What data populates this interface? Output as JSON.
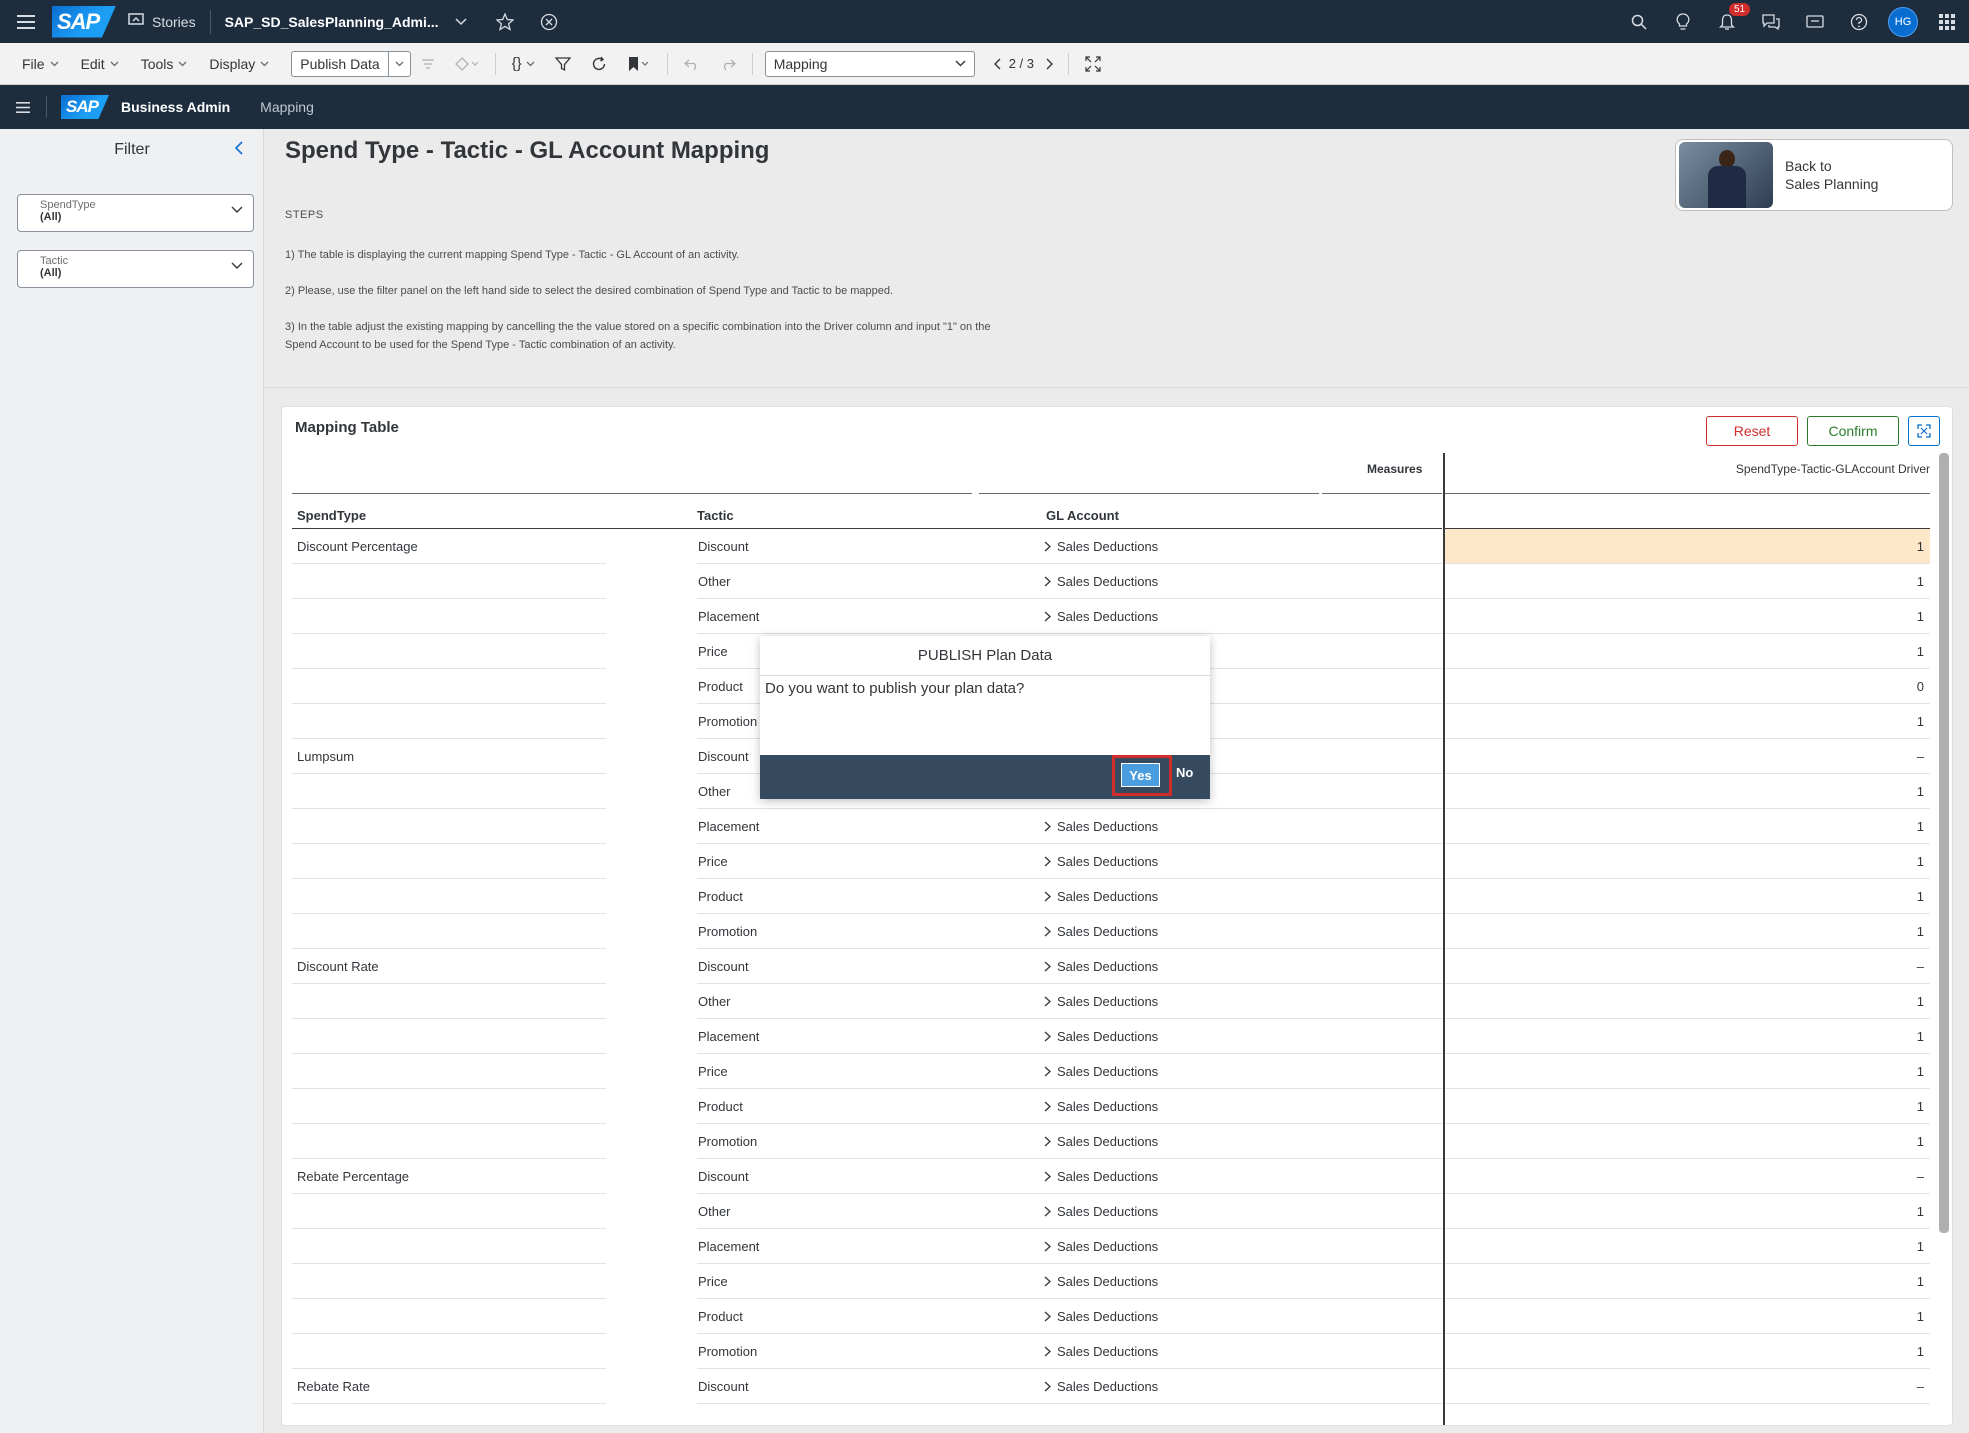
{
  "shell": {
    "logo": "SAP",
    "stories_label": "Stories",
    "story_title": "SAP_SD_SalesPlanning_Admi...",
    "notification_count": "51",
    "avatar_initials": "HG"
  },
  "toolbar": {
    "file": "File",
    "edit": "Edit",
    "tools": "Tools",
    "display": "Display",
    "publish_data": "Publish Data",
    "braces": "{}",
    "page_dropdown": "Mapping",
    "page_indicator": "2 / 3"
  },
  "subheader": {
    "logo": "SAP",
    "title": "Business Admin",
    "tab": "Mapping"
  },
  "filter": {
    "title": "Filter",
    "items": [
      {
        "label": "SpendType",
        "value": "(All)"
      },
      {
        "label": "Tactic",
        "value": "(All)"
      }
    ]
  },
  "page": {
    "title": "Spend Type - Tactic - GL Account Mapping",
    "steps_heading": "STEPS",
    "step1": "1) The table is displaying the current mapping Spend Type - Tactic - GL Account of an activity.",
    "step2": "2) Please, use the filter panel on the left hand side to select the desired combination of Spend Type and Tactic to be mapped.",
    "step3a": "3) In the table adjust the existing mapping by cancelling the the value stored on a specific combination into the Driver column and input \"1\" on the",
    "step3b": "Spend Account to be used for the Spend Type - Tactic combination of an activity.",
    "back_line1": "Back to",
    "back_line2": "Sales Planning"
  },
  "table": {
    "title": "Mapping Table",
    "reset": "Reset",
    "confirm": "Confirm",
    "measures_label": "Measures",
    "driver_label": "SpendType-Tactic-GLAccount Driver",
    "columns": [
      "SpendType",
      "Tactic",
      "GL Account"
    ],
    "rows": [
      {
        "spend": "Discount Percentage",
        "tactic": "Discount",
        "gl": "Sales Deductions",
        "value": "1"
      },
      {
        "spend": "",
        "tactic": "Other",
        "gl": "Sales Deductions",
        "value": "1"
      },
      {
        "spend": "",
        "tactic": "Placement",
        "gl": "Sales Deductions",
        "value": "1"
      },
      {
        "spend": "",
        "tactic": "Price",
        "gl": "",
        "value": "1"
      },
      {
        "spend": "",
        "tactic": "Product",
        "gl": "",
        "value": "0"
      },
      {
        "spend": "",
        "tactic": "Promotion",
        "gl": "",
        "value": "1"
      },
      {
        "spend": "Lumpsum",
        "tactic": "Discount",
        "gl": "",
        "value": "–"
      },
      {
        "spend": "",
        "tactic": "Other",
        "gl": "",
        "value": "1"
      },
      {
        "spend": "",
        "tactic": "Placement",
        "gl": "Sales Deductions",
        "value": "1"
      },
      {
        "spend": "",
        "tactic": "Price",
        "gl": "Sales Deductions",
        "value": "1"
      },
      {
        "spend": "",
        "tactic": "Product",
        "gl": "Sales Deductions",
        "value": "1"
      },
      {
        "spend": "",
        "tactic": "Promotion",
        "gl": "Sales Deductions",
        "value": "1"
      },
      {
        "spend": "Discount Rate",
        "tactic": "Discount",
        "gl": "Sales Deductions",
        "value": "–"
      },
      {
        "spend": "",
        "tactic": "Other",
        "gl": "Sales Deductions",
        "value": "1"
      },
      {
        "spend": "",
        "tactic": "Placement",
        "gl": "Sales Deductions",
        "value": "1"
      },
      {
        "spend": "",
        "tactic": "Price",
        "gl": "Sales Deductions",
        "value": "1"
      },
      {
        "spend": "",
        "tactic": "Product",
        "gl": "Sales Deductions",
        "value": "1"
      },
      {
        "spend": "",
        "tactic": "Promotion",
        "gl": "Sales Deductions",
        "value": "1"
      },
      {
        "spend": "Rebate Percentage",
        "tactic": "Discount",
        "gl": "Sales Deductions",
        "value": "–"
      },
      {
        "spend": "",
        "tactic": "Other",
        "gl": "Sales Deductions",
        "value": "1"
      },
      {
        "spend": "",
        "tactic": "Placement",
        "gl": "Sales Deductions",
        "value": "1"
      },
      {
        "spend": "",
        "tactic": "Price",
        "gl": "Sales Deductions",
        "value": "1"
      },
      {
        "spend": "",
        "tactic": "Product",
        "gl": "Sales Deductions",
        "value": "1"
      },
      {
        "spend": "",
        "tactic": "Promotion",
        "gl": "Sales Deductions",
        "value": "1"
      },
      {
        "spend": "Rebate Rate",
        "tactic": "Discount",
        "gl": "Sales Deductions",
        "value": "–"
      }
    ]
  },
  "dialog": {
    "title": "PUBLISH Plan Data",
    "message": "Do you want to publish your plan data?",
    "yes": "Yes",
    "no": "No"
  }
}
